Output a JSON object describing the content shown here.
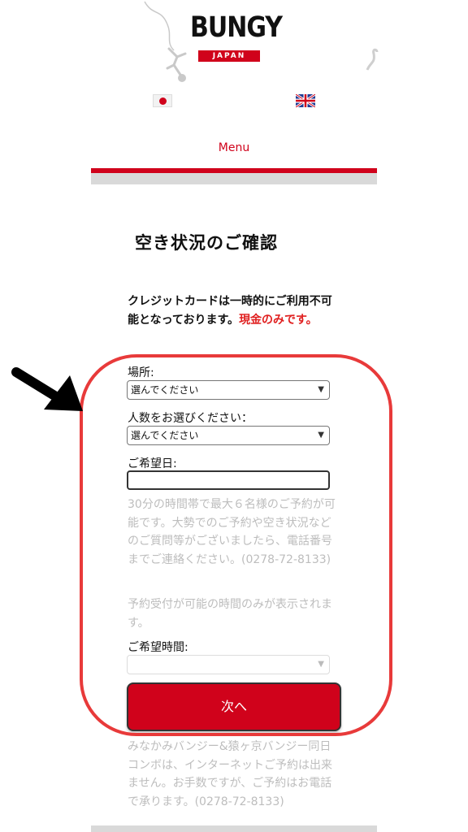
{
  "header": {
    "logo_text": "BUNGY",
    "logo_sub": "JAPAN",
    "lang_jp": "japanese-flag",
    "lang_en": "uk-flag",
    "menu_label": "Menu"
  },
  "page": {
    "title": "空き状況のご確認",
    "notice_text": "クレジットカードは一時的にご利用不可能となっております。",
    "notice_highlight": "現金のみです。"
  },
  "form": {
    "location_label": "場所:",
    "location_value": "選んでください",
    "people_label": "人数をお選びください：",
    "people_value": "選んでください",
    "date_label": "ご希望日:",
    "date_value": "",
    "info_text": "30分の時間帯で最大６名様のご予約が可能です。大勢でのご予約や空き状況などのご質問等がございましたら、電話番号までご連絡ください。(0278-72-8133)",
    "availability_note": "予約受付が可能の時間のみが表示されます。",
    "time_label": "ご希望時間:",
    "time_value": "",
    "next_button": "次へ"
  },
  "footer": {
    "combo_note": "みなかみバンジー&猿ヶ京バンジー同日コンボは、インターネットご予約は出来ません。お手数ですが、ご予約はお電話で承ります。(0278-72-8133)"
  },
  "colors": {
    "brand_red": "#d0021b",
    "highlight_red": "#e83a3a",
    "muted_text": "#bdbdbd"
  }
}
